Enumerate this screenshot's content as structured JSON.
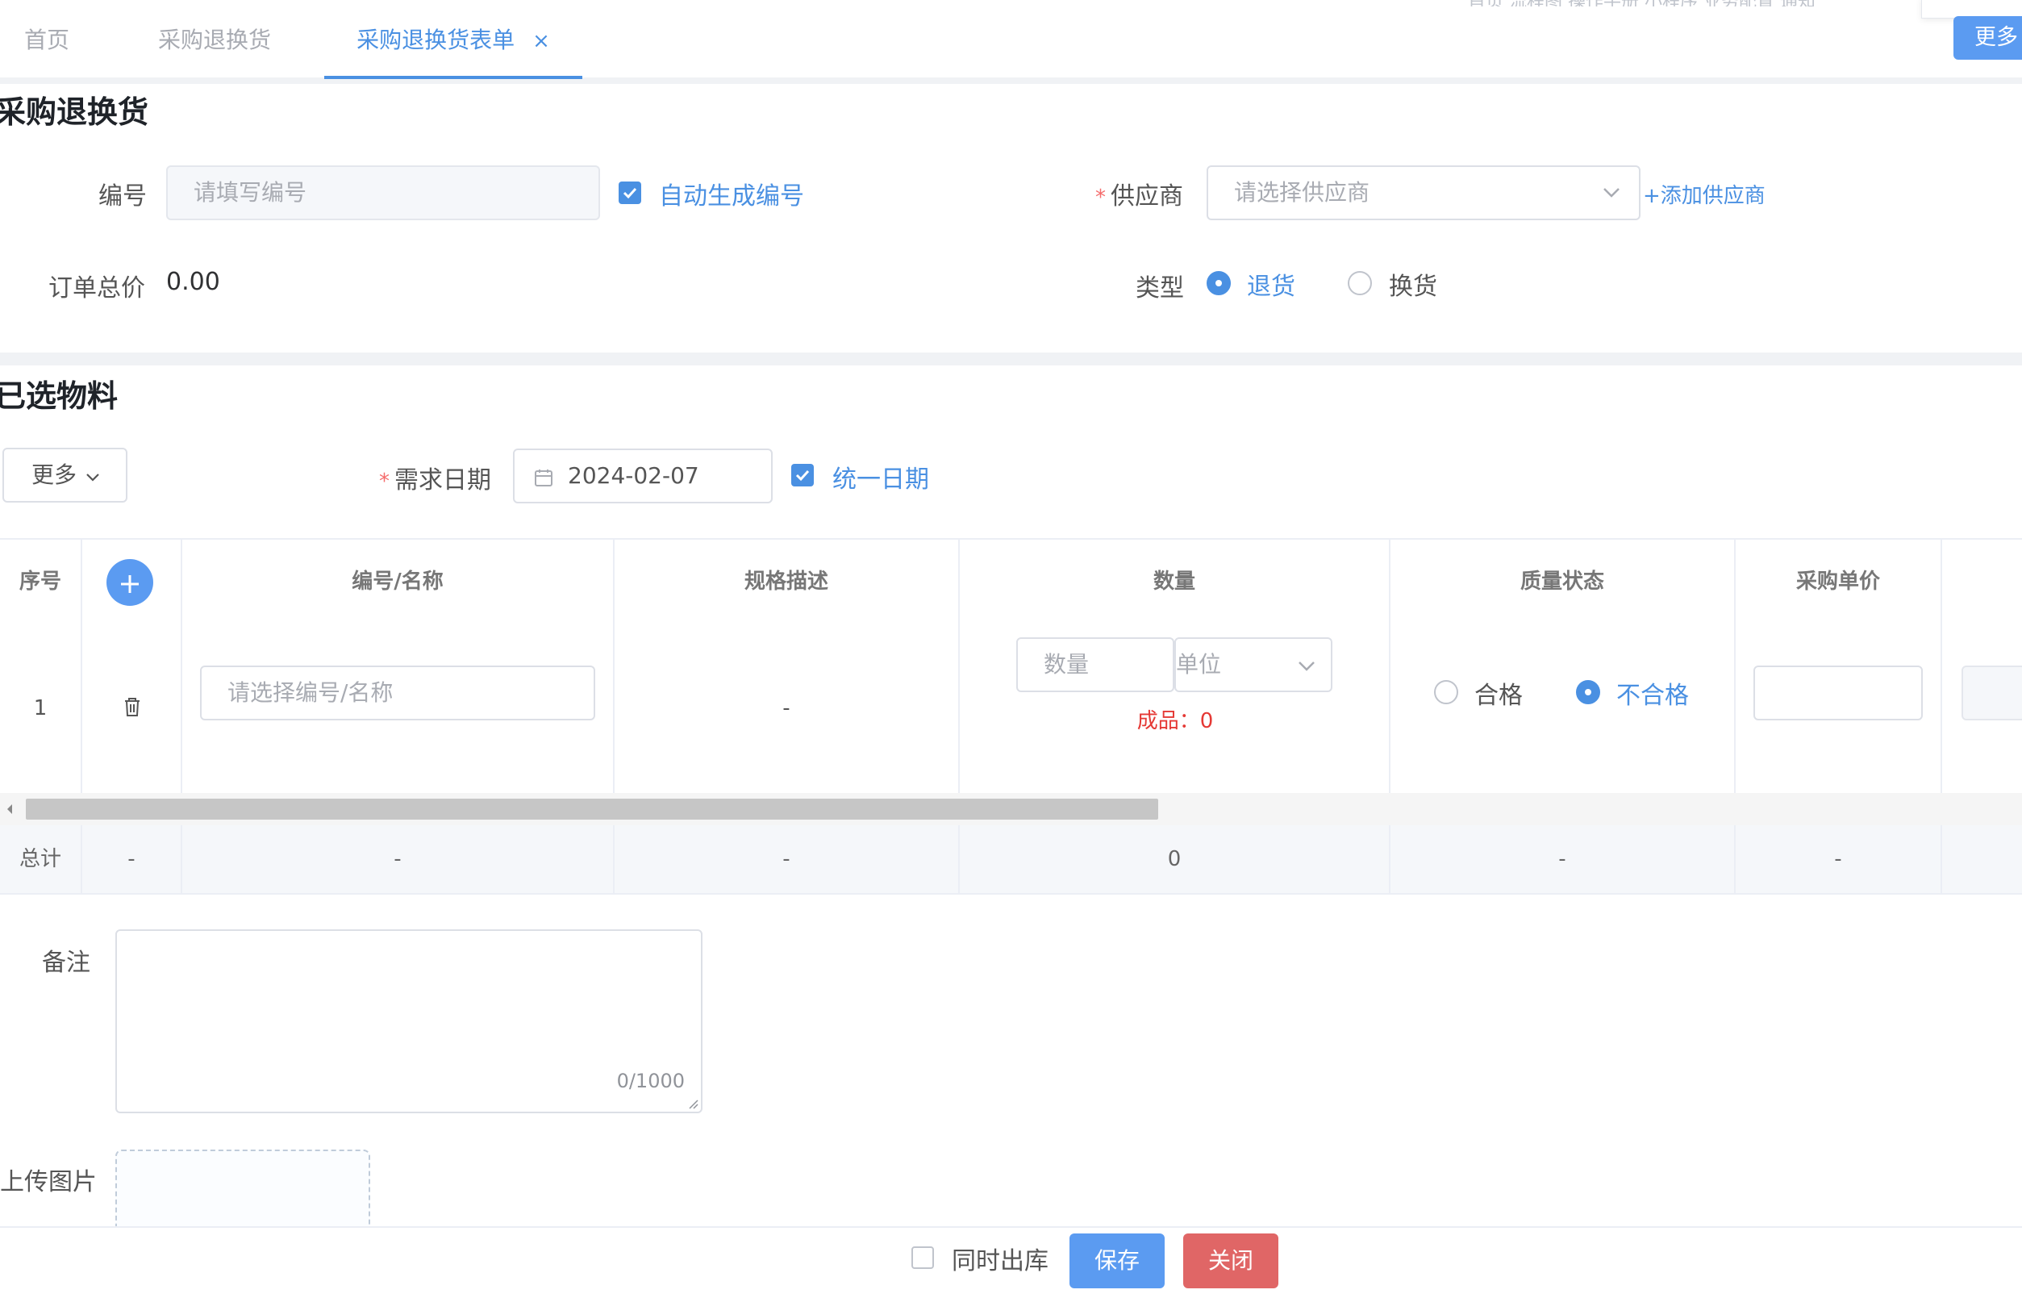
{
  "tabs": [
    {
      "label": "首页",
      "active": false
    },
    {
      "label": "采购退换货",
      "active": false
    },
    {
      "label": "采购退换货表单",
      "active": true,
      "closable": true,
      "close_icon": "close-icon"
    }
  ],
  "top_more_button": "更多",
  "top_faint_text": "首页  流程图  操作手册  小程序  业务配置  通知",
  "section1": {
    "title": "采购退换货",
    "code_label": "编号",
    "code_placeholder": "请填写编号",
    "auto_code_label": "自动生成编号",
    "supplier_label": "供应商",
    "supplier_placeholder": "请选择供应商",
    "add_supplier": "+添加供应商",
    "total_label": "订单总价",
    "total_value": "0.00",
    "type_label": "类型",
    "type_options": [
      {
        "label": "退货",
        "selected": true
      },
      {
        "label": "换货",
        "selected": false
      }
    ]
  },
  "section2": {
    "title": "已选物料",
    "more_dropdown": "更多",
    "date_label": "需求日期",
    "date_value": "2024-02-07",
    "unify_date_label": "统一日期"
  },
  "table": {
    "columns": [
      "序号",
      "编号/名称",
      "规格描述",
      "数量",
      "质量状态",
      "采购单价"
    ],
    "rows": [
      {
        "index": "1",
        "code_placeholder": "请选择编号/名称",
        "spec": "-",
        "qty_placeholder": "数量",
        "unit_placeholder": "单位",
        "finished_label": "成品：0",
        "quality_options": [
          {
            "label": "合格",
            "selected": false
          },
          {
            "label": "不合格",
            "selected": true
          }
        ]
      }
    ],
    "footer": [
      "总计",
      "-",
      "-",
      "-",
      "0",
      "-",
      "-"
    ]
  },
  "remark": {
    "label": "备注",
    "counter": "0/1000"
  },
  "upload": {
    "label": "上传图片"
  },
  "bottom": {
    "outbound_label": "同时出库",
    "save_label": "保存",
    "close_label": "关闭",
    "save_color": "#5b9bf1",
    "close_color": "#e06666"
  }
}
